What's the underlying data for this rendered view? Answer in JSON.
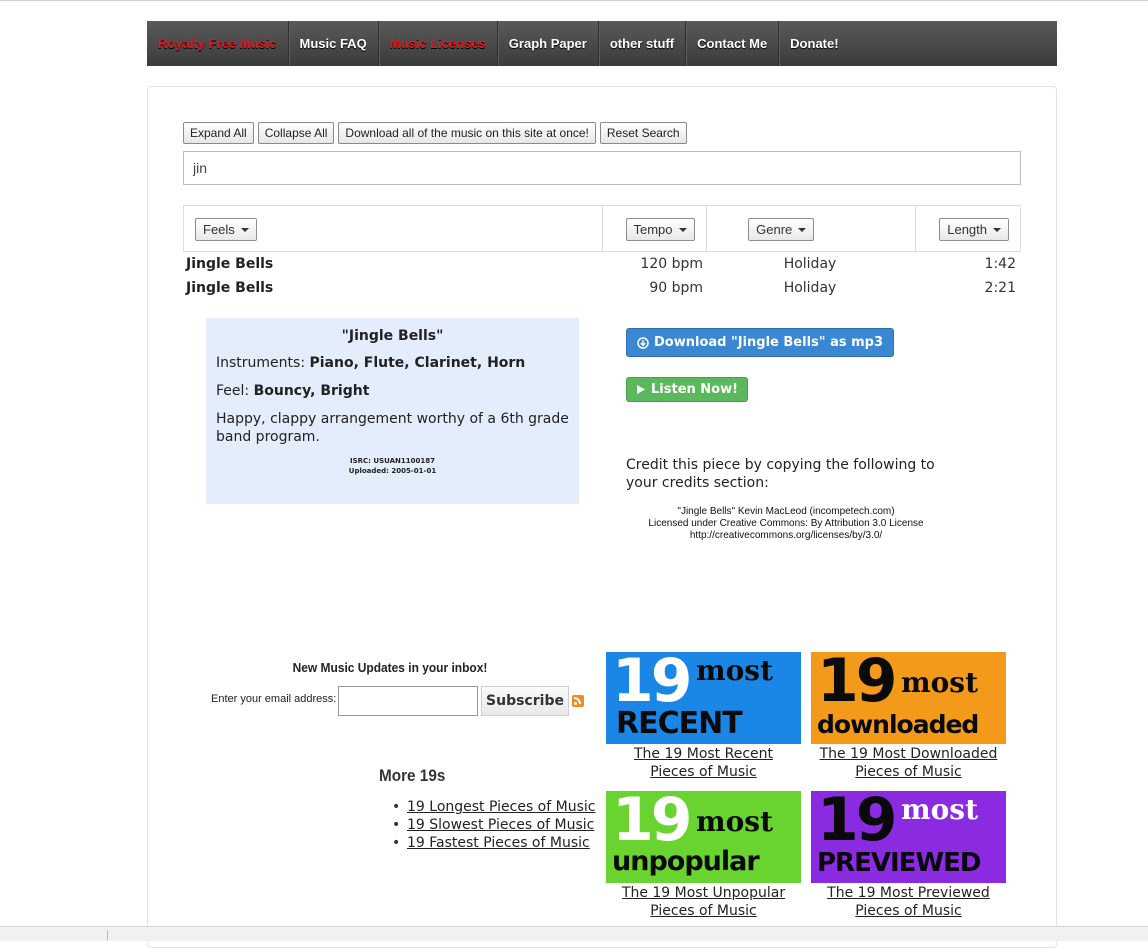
{
  "nav": {
    "items": [
      {
        "label": "Royalty Free Music",
        "color": "#e2161d"
      },
      {
        "label": "Music FAQ"
      },
      {
        "label": "Music Licenses",
        "color": "#e2161d"
      },
      {
        "label": "Graph Paper"
      },
      {
        "label": "other stuff"
      },
      {
        "label": "Contact Me"
      },
      {
        "label": "Donate!"
      }
    ]
  },
  "toolbar": {
    "expand_all": "Expand All",
    "collapse_all": "Collapse All",
    "download_all": "Download all of the music on this site at once!",
    "reset_search": "Reset Search"
  },
  "search": {
    "value": "jin"
  },
  "filters": {
    "feels": "Feels",
    "tempo": "Tempo",
    "genre": "Genre",
    "length": "Length"
  },
  "songs": [
    {
      "title": "Jingle Bells",
      "bpm": "120 bpm",
      "genre": "Holiday",
      "length": "1:42"
    },
    {
      "title": "Jingle Bells",
      "bpm": "90 bpm",
      "genre": "Holiday",
      "length": "2:21"
    }
  ],
  "detail": {
    "title": "\"Jingle Bells\"",
    "instruments_label": "Instruments: ",
    "instruments": "Piano, Flute, Clarinet, Horn",
    "feel_label": "Feel: ",
    "feel": "Bouncy, Bright",
    "description": "Happy, clappy arrangement worthy of a 6th grade band program.",
    "isrc": "ISRC: USUAN1100187",
    "uploaded": "Uploaded: 2005-01-01",
    "download_btn": "Download \"Jingle Bells\" as mp3",
    "listen_btn": "Listen Now!",
    "credit_lead": "Credit this piece by copying the following to your credits section:",
    "credit_line1": "\"Jingle Bells\" Kevin MacLeod (incompetech.com)",
    "credit_line2": "Licensed under Creative Commons: By Attribution 3.0 License",
    "credit_line3": "http://creativecommons.org/licenses/by/3.0/"
  },
  "newsletter": {
    "title": "New Music Updates in your inbox!",
    "label": "Enter your email address:",
    "button": "Subscribe"
  },
  "more19s": {
    "title": "More 19s",
    "links": [
      "19 Longest Pieces of Music",
      "19 Slowest Pieces of Music",
      "19 Fastest Pieces of Music"
    ]
  },
  "tiles": [
    {
      "num": "19",
      "most": "most",
      "word": "RECENT",
      "line1": "The 19 Most Recent",
      "line2": "Pieces of Music",
      "bg": "#1a86e6",
      "text": "#ffffff",
      "word_color": "#0a0a0a"
    },
    {
      "num": "19",
      "most": "most",
      "word": "downloaded",
      "line1": "The 19 Most Downloaded",
      "line2": "Pieces of Music",
      "bg": "#f39a1a",
      "text": "#0a0a0a",
      "word_color": "#0a0a0a"
    },
    {
      "num": "19",
      "most": "most",
      "word": "unpopular",
      "line1": "The 19 Most Unpopular",
      "line2": "Pieces of Music",
      "bg": "#69d430",
      "text": "#ffffff",
      "word_color": "#0a0a0a"
    },
    {
      "num": "19",
      "most": "most",
      "word": "PREVIEWED",
      "line1": "The 19 Most Previewed",
      "line2": "Pieces of Music",
      "bg": "#8a2be2",
      "text": "#0a0a0a",
      "word_color": "#0a0a0a"
    }
  ]
}
